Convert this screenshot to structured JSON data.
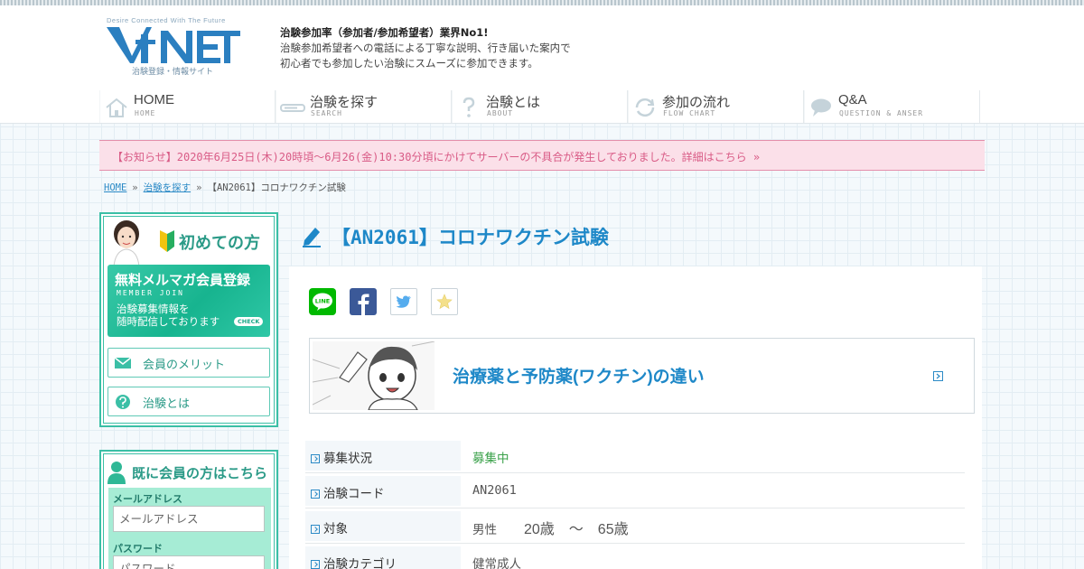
{
  "header": {
    "logo_tagline": "Desire Connected With The Future",
    "logo_text": "V-NET",
    "logo_sub": "治験登録・情報サイト",
    "intro_bold": "治験参加率（参加者/参加希望者）業界No1!",
    "intro_line1": "治験参加希望者への電話による丁寧な説明、行き届いた案内で",
    "intro_line2": "初心者でも参加したい治験にスムーズに参加できます。"
  },
  "nav": [
    {
      "label": "HOME",
      "sub": "HOME",
      "icon": "house-icon"
    },
    {
      "label": "治験を探す",
      "sub": "SEARCH",
      "icon": "search-bar-icon"
    },
    {
      "label": "治験とは",
      "sub": "ABOUT",
      "icon": "question-icon"
    },
    {
      "label": "参加の流れ",
      "sub": "FLOW CHART",
      "icon": "cycle-icon"
    },
    {
      "label": "Q&A",
      "sub": "QUESTION & ANSER",
      "icon": "speech-bubble-icon"
    }
  ],
  "notice": "【お知らせ】2020年6月25日(木)20時頃～6月26(金)10:30分頃にかけてサーバーの不具合が発生しておりました。詳細はこちら »",
  "breadcrumb": {
    "home": "HOME",
    "sep": "»",
    "search": "治験を探す",
    "current": "【AN2061】コロナワクチン試験"
  },
  "sidebar": {
    "first_time": "初めての方",
    "mag_title": "無料メルマガ会員登録",
    "mag_sub": "MEMBER JOIN",
    "mag_line1": "治験募集情報を",
    "mag_line2": "随時配信しております",
    "mag_check": "CHECK",
    "btn_merit": "会員のメリット",
    "btn_about": "治験とは",
    "member_head": "既に会員の方はこちら",
    "email_label": "メールアドレス",
    "email_placeholder": "メールアドレス",
    "password_label": "パスワード",
    "password_placeholder": "パスワード"
  },
  "main": {
    "title": "【AN2061】コロナワクチン試験",
    "share": {
      "line": "LINE"
    },
    "banner_title": "治療薬と予防薬(ワクチン)の違い",
    "spec": {
      "status_label": "募集状況",
      "status_value": "募集中",
      "code_label": "治験コード",
      "code_value": "AN2061",
      "target_label": "対象",
      "target_gender": "男性",
      "target_age": "20歳　～　65歳",
      "category_label": "治験カテゴリ",
      "category_value": "健常成人"
    }
  },
  "colors": {
    "accent_blue": "#1e88c8",
    "accent_green": "#3bbfa6",
    "notice_pink": "#fbe0e9",
    "status_green": "#3aa14a"
  }
}
